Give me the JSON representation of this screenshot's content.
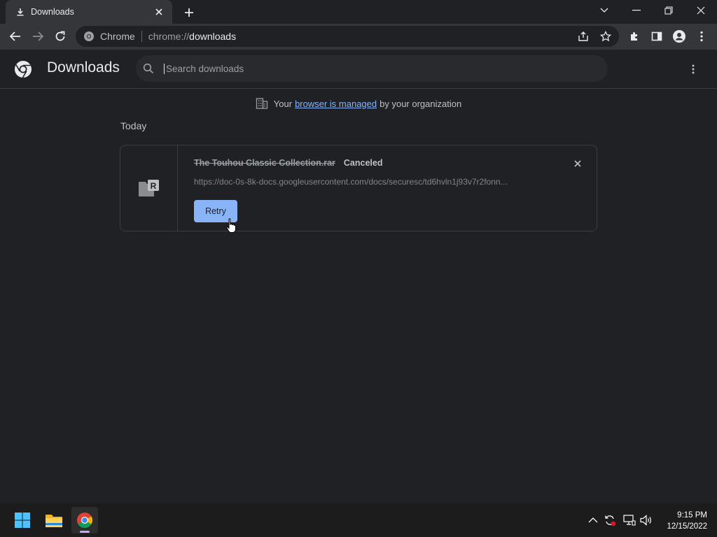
{
  "tab": {
    "title": "Downloads",
    "icon": "download-icon"
  },
  "omnibox": {
    "site_label": "Chrome",
    "url_scheme": "chrome://",
    "url_host": "downloads"
  },
  "header": {
    "title": "Downloads",
    "search_placeholder": "Search downloads"
  },
  "managed": {
    "prefix": "Your",
    "link": "browser is managed",
    "suffix": "by your organization"
  },
  "section": {
    "label": "Today"
  },
  "download": {
    "file_name": "The Touhou Classic Collection.rar",
    "status": "Canceled",
    "url": "https://doc-0s-8k-docs.googleusercontent.com/docs/securesc/td6hvln1j93v7r2fonn...",
    "retry_label": "Retry",
    "file_icon": "rar-file-icon"
  },
  "taskbar": {
    "time": "9:15 PM",
    "date": "12/15/2022"
  },
  "colors": {
    "accent": "#8ab4f8",
    "background": "#202124",
    "toolbar": "#35363a"
  }
}
